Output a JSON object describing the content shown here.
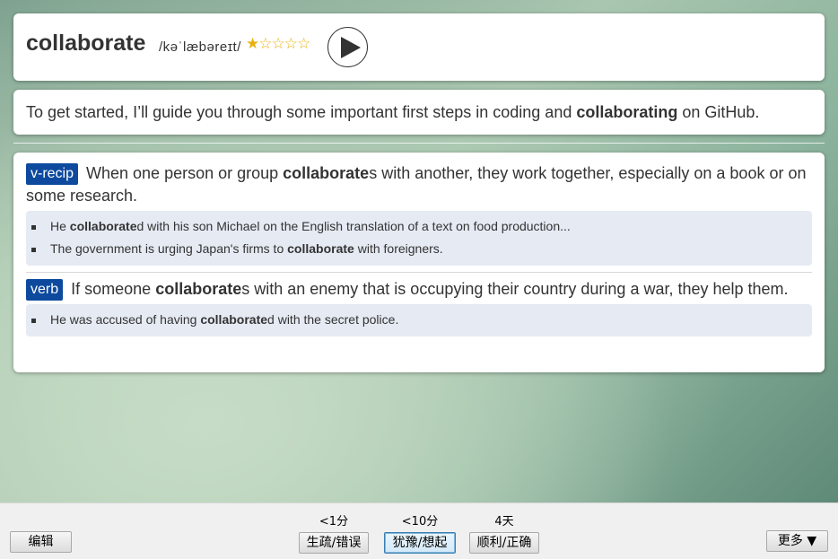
{
  "word_card": {
    "headword": "collaborate",
    "phonetic": "/kəˈlæbəreɪt/",
    "rating": 1,
    "rating_max": 5,
    "star_filled": "★",
    "star_empty": "☆☆☆☆",
    "play_icon": "play-icon"
  },
  "sentence_card": {
    "before": "To get started, I’ll guide you through some important first steps in coding and ",
    "highlight": "collaborating",
    "after": " on GitHub."
  },
  "senses": [
    {
      "pos": "v-recip",
      "def_before": " When one person or group ",
      "def_bold": "collaborate",
      "def_after": "s with another, they work together, especially on a book or on some research.",
      "examples": [
        {
          "before": "He ",
          "bold": "collaborate",
          "after": "d with his son Michael on the English translation of a text on food production..."
        },
        {
          "before": "The government is urging Japan's firms to ",
          "bold": "collaborate",
          "after": " with foreigners."
        }
      ]
    },
    {
      "pos": "verb",
      "def_before": " If someone ",
      "def_bold": "collaborate",
      "def_after": "s with an enemy that is occupying their country during a war, they help them.",
      "examples": [
        {
          "before": "He was accused of having ",
          "bold": "collaborate",
          "after": "d with the secret police."
        }
      ]
    }
  ],
  "bottom_bar": {
    "edit_label": "编辑",
    "more_label": "更多 ▼",
    "answers": [
      {
        "interval": "<1分",
        "label": "生疏/错误"
      },
      {
        "interval": "<10分",
        "label": "犹豫/想起"
      },
      {
        "interval": "4天",
        "label": "顺利/正确"
      }
    ]
  },
  "colors": {
    "pos_tag_bg": "#0d4a9e",
    "star": "#e8b20e",
    "example_bg": "#e5eaf3"
  }
}
